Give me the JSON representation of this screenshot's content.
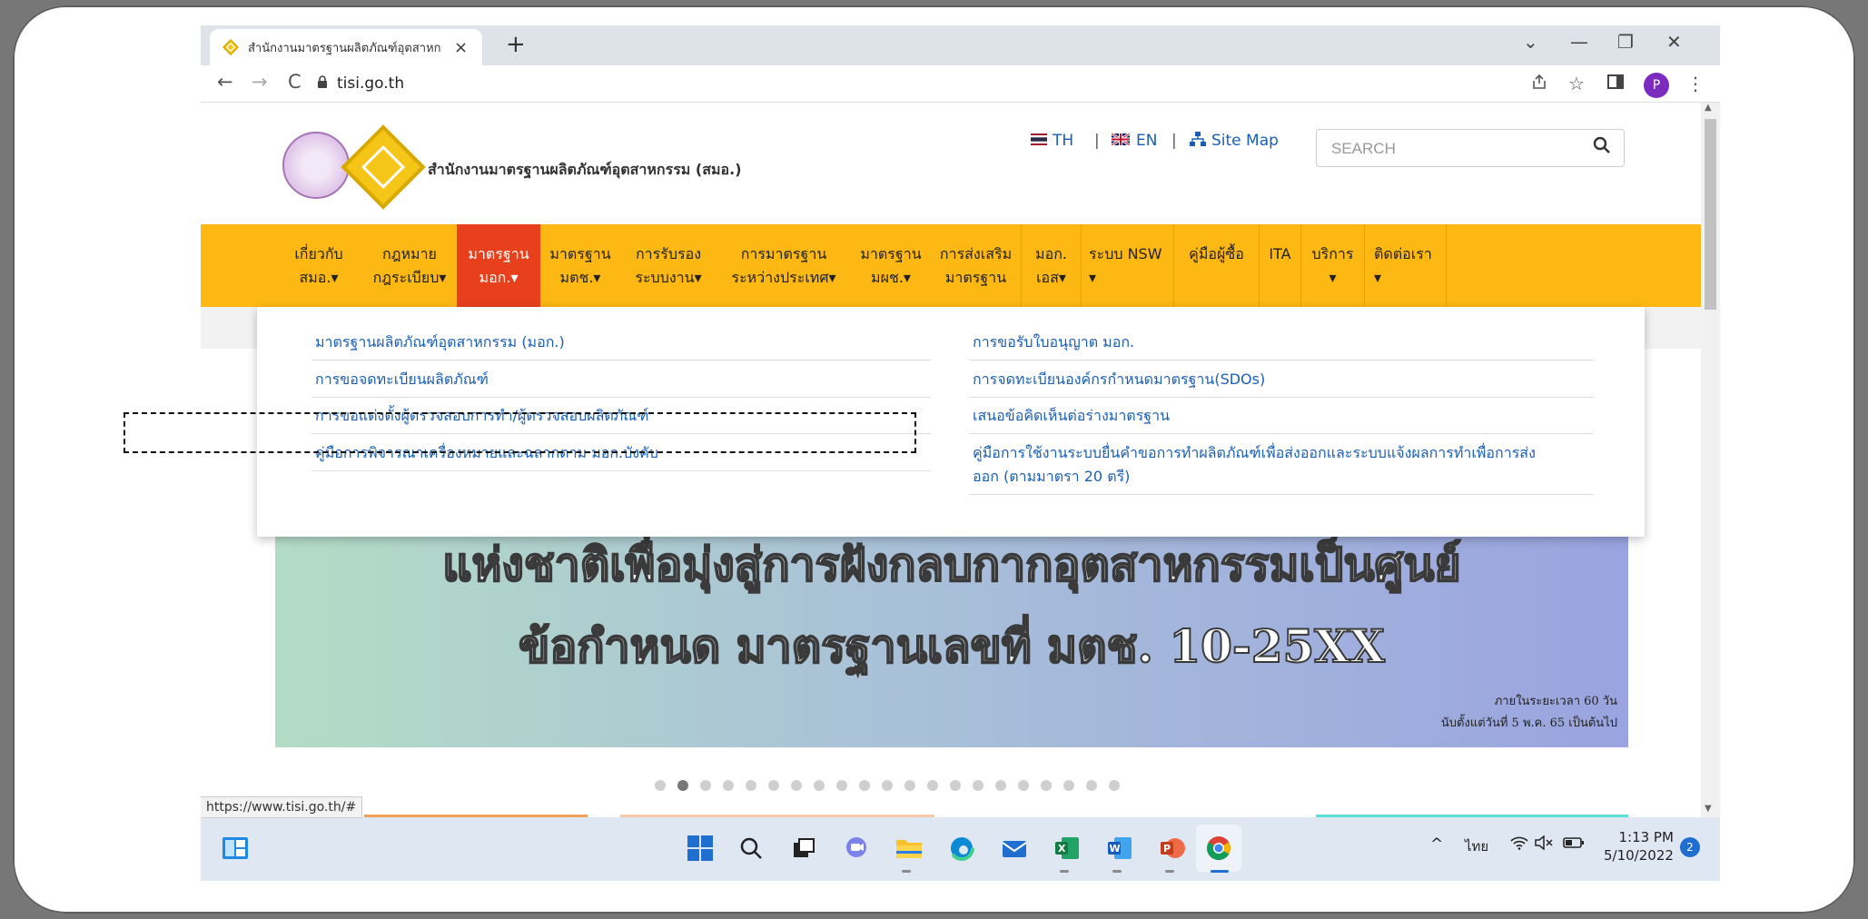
{
  "browser": {
    "tab_title": "สำนักงานมาตรฐานผลิตภัณฑ์อุตสาหก",
    "tab_close": "×",
    "new_tab": "+",
    "url": "tisi.go.th",
    "window_controls": {
      "dropdown": "⌄",
      "minimize": "—",
      "restore": "❐",
      "close": "✕"
    },
    "nav": {
      "back": "←",
      "forward": "→",
      "reload": "C"
    },
    "profile_initial": "P",
    "status_url": "https://www.tisi.go.th/#"
  },
  "header": {
    "site_name": "สำนักงานมาตรฐานผลิตภัณฑ์อุตสาหกรรม (สมอ.)",
    "lang_th": "TH",
    "lang_en": "EN",
    "sitemap": "Site Map",
    "separator": "|",
    "search_placeholder": "SEARCH"
  },
  "menu": {
    "items": [
      {
        "line1": "เกี่ยวกับ",
        "line2": "สมอ.▾"
      },
      {
        "line1": "กฎหมาย",
        "line2": "กฎระเบียบ▾"
      },
      {
        "line1": "มาตรฐาน",
        "line2": "มอก.▾"
      },
      {
        "line1": "มาตรฐาน",
        "line2": "มตช.▾"
      },
      {
        "line1": "การรับรอง",
        "line2": "ระบบงาน▾"
      },
      {
        "line1": "การมาตรฐาน",
        "line2": "ระหว่างประเทศ▾"
      },
      {
        "line1": "มาตรฐาน",
        "line2": "มผช.▾"
      },
      {
        "line1": "การส่งเสริม",
        "line2": "มาตรฐาน"
      },
      {
        "line1": "มอก.",
        "line2": "เอส▾"
      },
      {
        "line1": "ระบบ NSW",
        "line2": "▾"
      },
      {
        "line1": "คู่มือผู้ซื้อ",
        "line2": ""
      },
      {
        "line1": "ITA",
        "line2": ""
      },
      {
        "line1": "บริการ",
        "line2": "▾"
      },
      {
        "line1": "ติดต่อเรา",
        "line2": "▾"
      }
    ],
    "active_color": "#e8401d",
    "bar_color": "#fdb813"
  },
  "dropdown": {
    "left": [
      "มาตรฐานผลิตภัณฑ์อุตสาหกรรม (มอก.)",
      "การขอจดทะเบียนผลิตภัณฑ์",
      "การขอแต่งตั้งผู้ตรวจสอบการทำ/ผู้ตรวจสอบผลิตภัณฑ์",
      "คู่มือการพิจารณาเครื่องหมายและฉลากตาม มอก.บังคับ"
    ],
    "right": [
      "การขอรับใบอนุญาต มอก.",
      "การจดทะเบียนองค์กรกำหนดมาตรฐาน(SDOs)",
      "เสนอข้อคิดเห็นต่อร่างมาตรฐาน",
      "คู่มือการใช้งานระบบยื่นคำขอการทำผลิตภัณฑ์เพื่อส่งออกและระบบแจ้งผลการทำเพื่อการส่ง",
      "ออก (ตามมาตรา 20 ตรี)"
    ]
  },
  "banner": {
    "line2": "แห่งชาติเพื่อมุ่งสู่การฝังกลบกากอุตสาหกรรมเป็นศูนย์",
    "line3": "ข้อกำหนด มาตรฐานเลขที่ มตช. 10-25XX",
    "small1": "ภายในระยะเวลา 60 วัน",
    "small2": "นับตั้งแต่วันที่ 5 พ.ค. 65 เป็นต้นไป",
    "dots_total": 21,
    "dots_active": 2
  },
  "taskbar": {
    "lang": "ไทย",
    "time": "1:13 PM",
    "date": "5/10/2022",
    "notifications": "2"
  }
}
